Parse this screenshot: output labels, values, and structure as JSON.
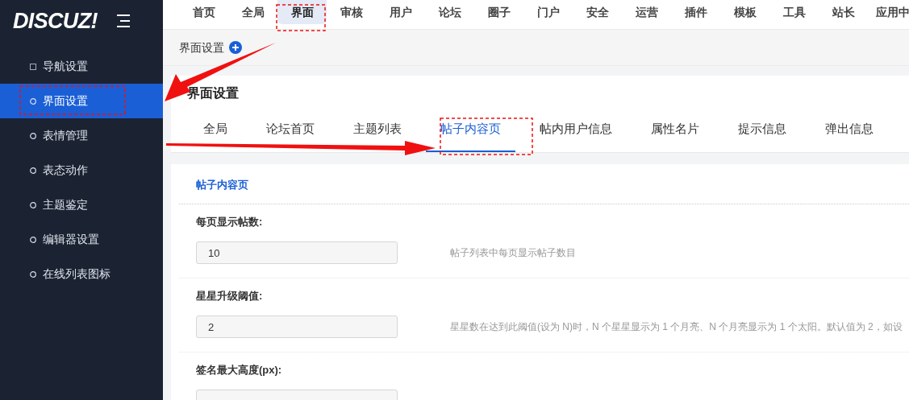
{
  "logo": "DISCUZ!",
  "top_nav": [
    {
      "label": "首页",
      "selected": false
    },
    {
      "label": "全局",
      "selected": false
    },
    {
      "label": "界面",
      "selected": true
    },
    {
      "label": "审核",
      "selected": false
    },
    {
      "label": "用户",
      "selected": false
    },
    {
      "label": "论坛",
      "selected": false
    },
    {
      "label": "圈子",
      "selected": false
    },
    {
      "label": "门户",
      "selected": false
    },
    {
      "label": "安全",
      "selected": false
    },
    {
      "label": "运营",
      "selected": false
    },
    {
      "label": "插件",
      "selected": false
    },
    {
      "label": "模板",
      "selected": false
    },
    {
      "label": "工具",
      "selected": false
    },
    {
      "label": "站长",
      "selected": false
    },
    {
      "label": "应用中",
      "selected": false
    }
  ],
  "breadcrumb": "界面设置",
  "sidebar": {
    "items": [
      {
        "label": "导航设置",
        "kind": "square",
        "selected": false
      },
      {
        "label": "界面设置",
        "kind": "circle",
        "selected": true
      },
      {
        "label": "表情管理",
        "kind": "circle",
        "selected": false
      },
      {
        "label": "表态动作",
        "kind": "circle",
        "selected": false
      },
      {
        "label": "主题鉴定",
        "kind": "circle",
        "selected": false
      },
      {
        "label": "编辑器设置",
        "kind": "circle",
        "selected": false
      },
      {
        "label": "在线列表图标",
        "kind": "circle",
        "selected": false
      }
    ]
  },
  "panel": {
    "title": "界面设置",
    "tabs": [
      {
        "label": "全局",
        "selected": false
      },
      {
        "label": "论坛首页",
        "selected": false
      },
      {
        "label": "主题列表",
        "selected": false
      },
      {
        "label": "帖子内容页",
        "selected": true
      },
      {
        "label": "帖内用户信息",
        "selected": false
      },
      {
        "label": "属性名片",
        "selected": false
      },
      {
        "label": "提示信息",
        "selected": false
      },
      {
        "label": "弹出信息",
        "selected": false
      }
    ],
    "section_title": "帖子内容页",
    "settings": [
      {
        "label": "每页显示帖数:",
        "value": "10",
        "hint": "帖子列表中每页显示帖子数目"
      },
      {
        "label": "星星升级阈值:",
        "value": "2",
        "hint": "星星数在达到此阈值(设为 N)时，N 个星星显示为 1 个月亮、N 个月亮显示为 1 个太阳。默认值为 2，如设"
      },
      {
        "label": "签名最大高度(px):"
      }
    ]
  }
}
